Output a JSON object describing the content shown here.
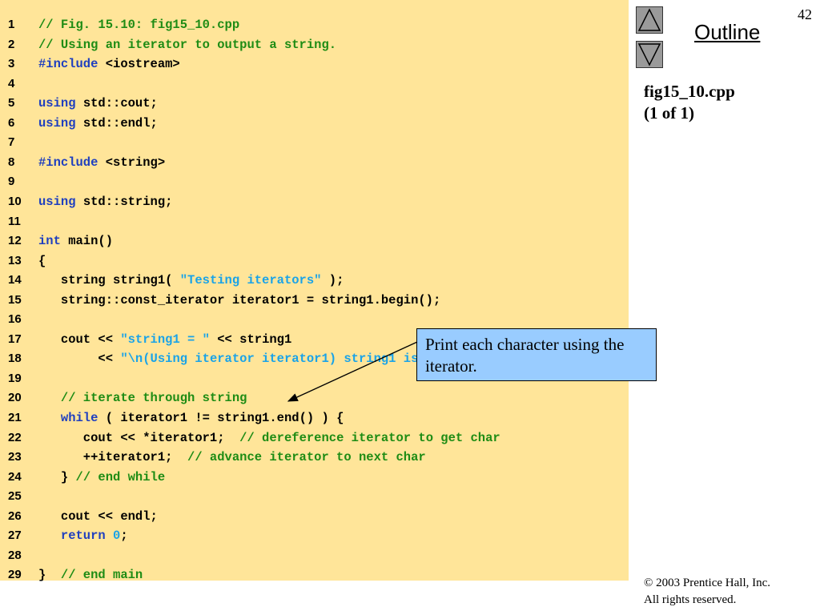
{
  "slide": {
    "number": "42",
    "outline_label": "Outline",
    "file_name": "fig15_10.cpp",
    "file_part": "(1 of 1)",
    "callout_text": "Print each character using the iterator.",
    "copyright_line1": "© 2003 Prentice Hall, Inc.",
    "copyright_line2": "All rights reserved."
  },
  "nav": {
    "up_icon": "triangle-up-icon",
    "down_icon": "triangle-down-icon"
  },
  "colors": {
    "code_background": "#ffe599",
    "keyword": "#1f3fbf",
    "comment": "#1e8c14",
    "string_literal": "#1aa3e8",
    "callout_background": "#99ccff"
  },
  "code_lines": [
    {
      "n": "1",
      "tokens": [
        {
          "t": "// Fig. 15.10: fig15_10.cpp",
          "c": "cm"
        }
      ]
    },
    {
      "n": "2",
      "tokens": [
        {
          "t": "// Using an iterator to output a string.",
          "c": "cm"
        }
      ]
    },
    {
      "n": "3",
      "tokens": [
        {
          "t": "#include",
          "c": "kw"
        },
        {
          "t": " <iostream>",
          "c": ""
        }
      ]
    },
    {
      "n": "4",
      "tokens": []
    },
    {
      "n": "5",
      "tokens": [
        {
          "t": "using",
          "c": "kw"
        },
        {
          "t": " std::cout;",
          "c": ""
        }
      ]
    },
    {
      "n": "6",
      "tokens": [
        {
          "t": "using",
          "c": "kw"
        },
        {
          "t": " std::endl;",
          "c": ""
        }
      ]
    },
    {
      "n": "7",
      "tokens": []
    },
    {
      "n": "8",
      "tokens": [
        {
          "t": "#include",
          "c": "kw"
        },
        {
          "t": " <string>",
          "c": ""
        }
      ]
    },
    {
      "n": "9",
      "tokens": []
    },
    {
      "n": "10",
      "tokens": [
        {
          "t": "using",
          "c": "kw"
        },
        {
          "t": " std::string;",
          "c": ""
        }
      ]
    },
    {
      "n": "11",
      "tokens": []
    },
    {
      "n": "12",
      "tokens": [
        {
          "t": "int",
          "c": "kw"
        },
        {
          "t": " main()",
          "c": ""
        }
      ]
    },
    {
      "n": "13",
      "tokens": [
        {
          "t": "{",
          "c": ""
        }
      ]
    },
    {
      "n": "14",
      "tokens": [
        {
          "t": "   string string1( ",
          "c": ""
        },
        {
          "t": "\"Testing iterators\"",
          "c": "st"
        },
        {
          "t": " );",
          "c": ""
        }
      ]
    },
    {
      "n": "15",
      "tokens": [
        {
          "t": "   string::const_iterator iterator1 = string1.begin();",
          "c": ""
        }
      ]
    },
    {
      "n": "16",
      "tokens": []
    },
    {
      "n": "17",
      "tokens": [
        {
          "t": "   cout << ",
          "c": ""
        },
        {
          "t": "\"string1 = \"",
          "c": "st"
        },
        {
          "t": " << string1",
          "c": ""
        }
      ]
    },
    {
      "n": "18",
      "tokens": [
        {
          "t": "        << ",
          "c": ""
        },
        {
          "t": "\"\\n(Using iterator iterator1) string1 is: \"",
          "c": "st"
        },
        {
          "t": ";",
          "c": ""
        }
      ]
    },
    {
      "n": "19",
      "tokens": []
    },
    {
      "n": "20",
      "tokens": [
        {
          "t": "   ",
          "c": ""
        },
        {
          "t": "// iterate through string",
          "c": "cm"
        }
      ]
    },
    {
      "n": "21",
      "tokens": [
        {
          "t": "   ",
          "c": ""
        },
        {
          "t": "while",
          "c": "kw"
        },
        {
          "t": " ( iterator1 != string1.end() ) {",
          "c": ""
        }
      ]
    },
    {
      "n": "22",
      "tokens": [
        {
          "t": "      cout << *iterator1;  ",
          "c": ""
        },
        {
          "t": "// dereference iterator to get char",
          "c": "cm"
        }
      ]
    },
    {
      "n": "23",
      "tokens": [
        {
          "t": "      ++iterator1;  ",
          "c": ""
        },
        {
          "t": "// advance iterator to next char",
          "c": "cm"
        }
      ]
    },
    {
      "n": "24",
      "tokens": [
        {
          "t": "   } ",
          "c": ""
        },
        {
          "t": "// end while",
          "c": "cm"
        }
      ]
    },
    {
      "n": "25",
      "tokens": []
    },
    {
      "n": "26",
      "tokens": [
        {
          "t": "   cout << endl;",
          "c": ""
        }
      ]
    },
    {
      "n": "27",
      "tokens": [
        {
          "t": "   ",
          "c": ""
        },
        {
          "t": "return",
          "c": "kw"
        },
        {
          "t": " ",
          "c": ""
        },
        {
          "t": "0",
          "c": "num"
        },
        {
          "t": ";",
          "c": ""
        }
      ]
    },
    {
      "n": "28",
      "tokens": []
    },
    {
      "n": "29",
      "tokens": [
        {
          "t": "}  ",
          "c": ""
        },
        {
          "t": "// end main",
          "c": "cm"
        }
      ]
    }
  ]
}
